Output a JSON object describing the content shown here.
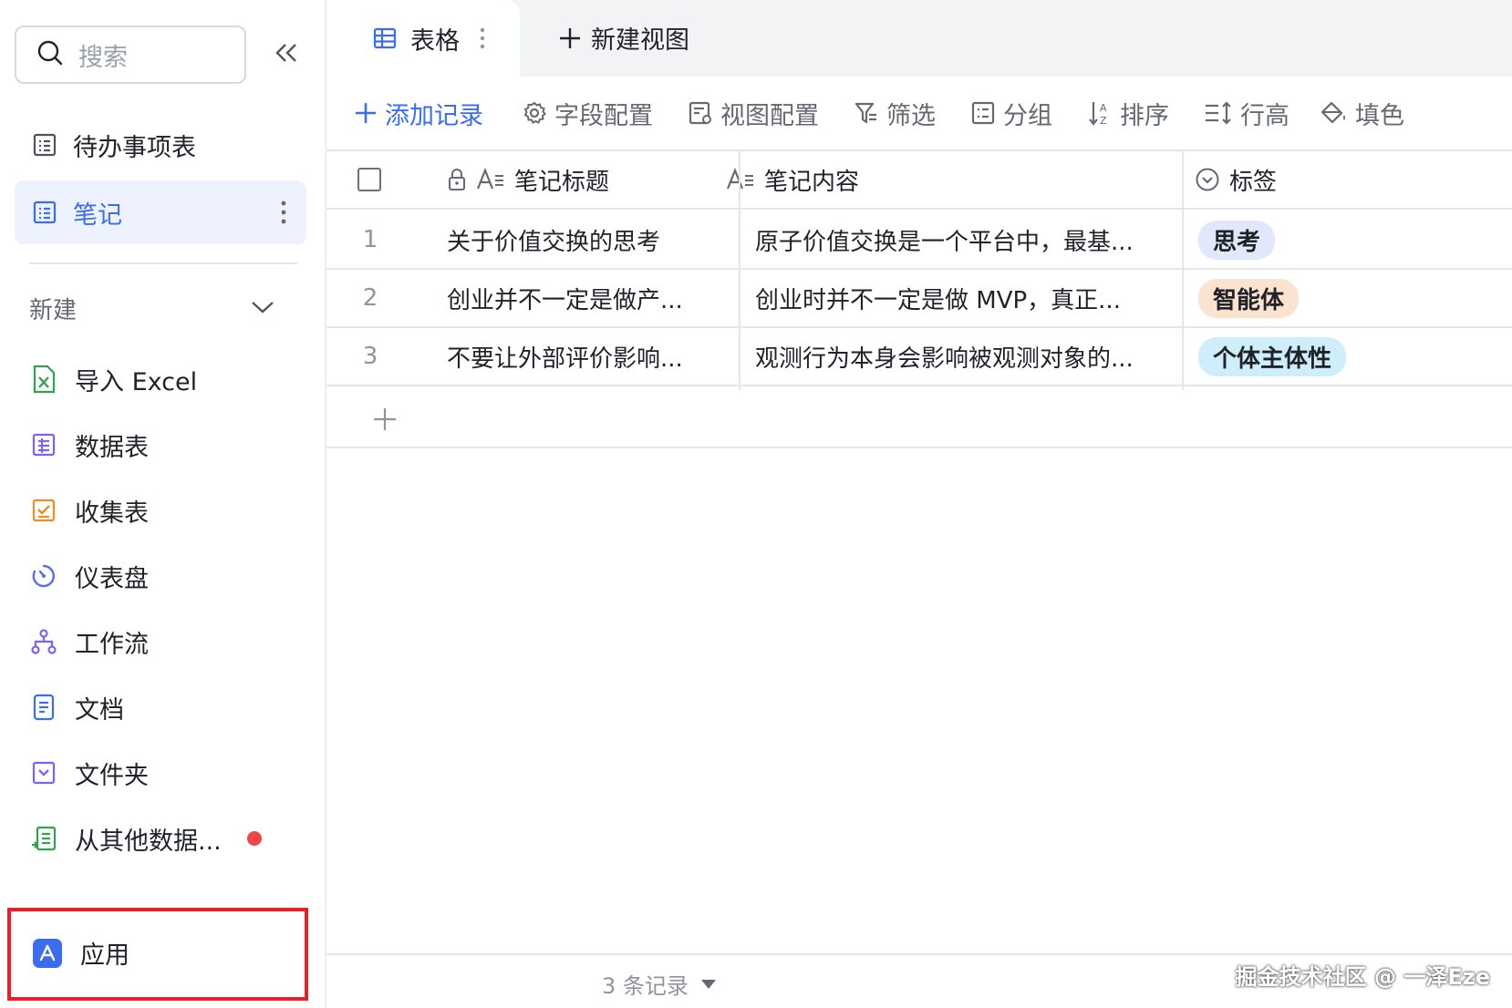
{
  "sidebar": {
    "search_placeholder": "搜索",
    "tables": [
      {
        "label": "待办事项表"
      },
      {
        "label": "笔记"
      }
    ],
    "section_label": "新建",
    "create_items": [
      {
        "label": "导入 Excel",
        "icon": "excel-icon",
        "color": "#2ea44f"
      },
      {
        "label": "数据表",
        "icon": "datasheet-icon",
        "color": "#7b61ff"
      },
      {
        "label": "收集表",
        "icon": "form-icon",
        "color": "#f08a24"
      },
      {
        "label": "仪表盘",
        "icon": "dashboard-icon",
        "color": "#5b6cf0"
      },
      {
        "label": "工作流",
        "icon": "workflow-icon",
        "color": "#7b61ff"
      },
      {
        "label": "文档",
        "icon": "document-icon",
        "color": "#3a6df0"
      },
      {
        "label": "文件夹",
        "icon": "folder-icon",
        "color": "#7b61ff"
      },
      {
        "label": "从其他数据...",
        "icon": "import-data-icon",
        "color": "#2ea44f"
      }
    ],
    "apps_label": "应用"
  },
  "tabs": {
    "active_label": "表格",
    "new_view_label": "新建视图"
  },
  "toolbar": {
    "add_record": "添加记录",
    "field_config": "字段配置",
    "view_config": "视图配置",
    "filter": "筛选",
    "group": "分组",
    "sort": "排序",
    "row_height": "行高",
    "fill_color": "填色"
  },
  "table": {
    "columns": [
      "笔记标题",
      "笔记内容",
      "标签"
    ],
    "rows": [
      {
        "num": "1",
        "title": "关于价值交换的思考",
        "content": "原子价值交换是一个平台中，最基...",
        "tag": "思考",
        "tag_bg": "#e1e8fb",
        "tag_color": "#1f2329"
      },
      {
        "num": "2",
        "title": "创业并不一定是做产...",
        "content": "创业时并不一定是做 MVP，真正...",
        "tag": "智能体",
        "tag_bg": "#fbe3cf",
        "tag_color": "#1f2329"
      },
      {
        "num": "3",
        "title": "不要让外部评价影响...",
        "content": "观测行为本身会影响被观测对象的...",
        "tag": "个体主体性",
        "tag_bg": "#cdeefa",
        "tag_color": "#1f2329"
      }
    ]
  },
  "footer": {
    "record_count": "3 条记录",
    "watermark": "掘金技术社区 @ 一泽Eze"
  }
}
